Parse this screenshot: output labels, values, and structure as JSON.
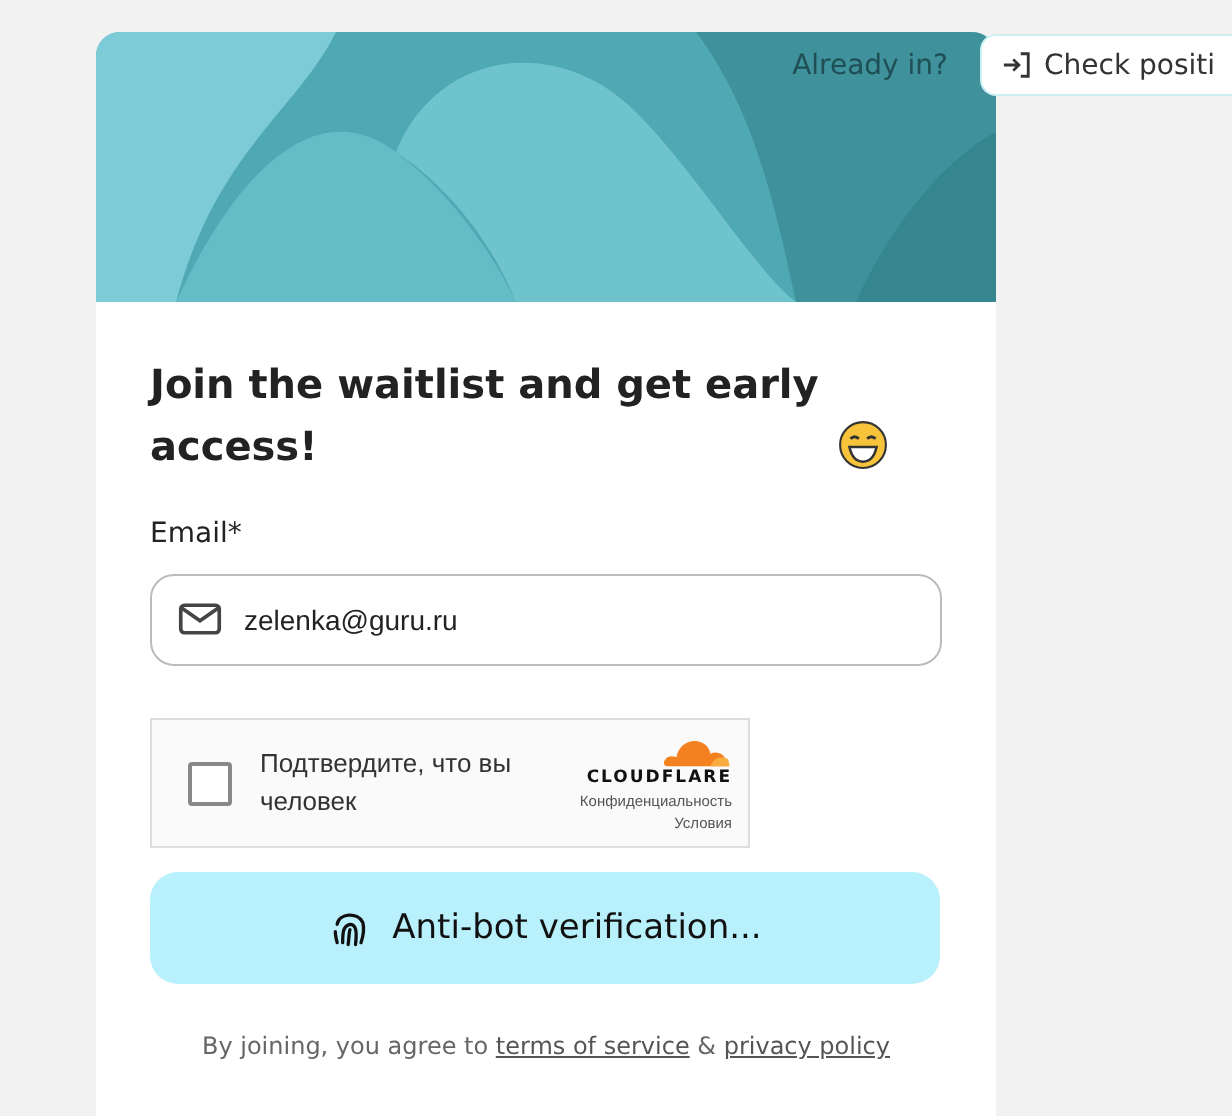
{
  "header": {
    "prompt": "Already in?",
    "check_button": "Check positi"
  },
  "heading": "Join the waitlist and get early access!",
  "email": {
    "label": "Email*",
    "value": "zelenka@guru.ru"
  },
  "captcha": {
    "label": "Подтвердите, что вы человек",
    "checked": false,
    "brand": "CLOUDFLARE",
    "privacy": "Конфиденциальность",
    "terms": "Условия"
  },
  "submit": "Anti-bot verification...",
  "consent": {
    "text": "By joining, you agree to",
    "terms_link": "terms of service",
    "joiner": "&",
    "privacy_link": "privacy policy"
  }
}
